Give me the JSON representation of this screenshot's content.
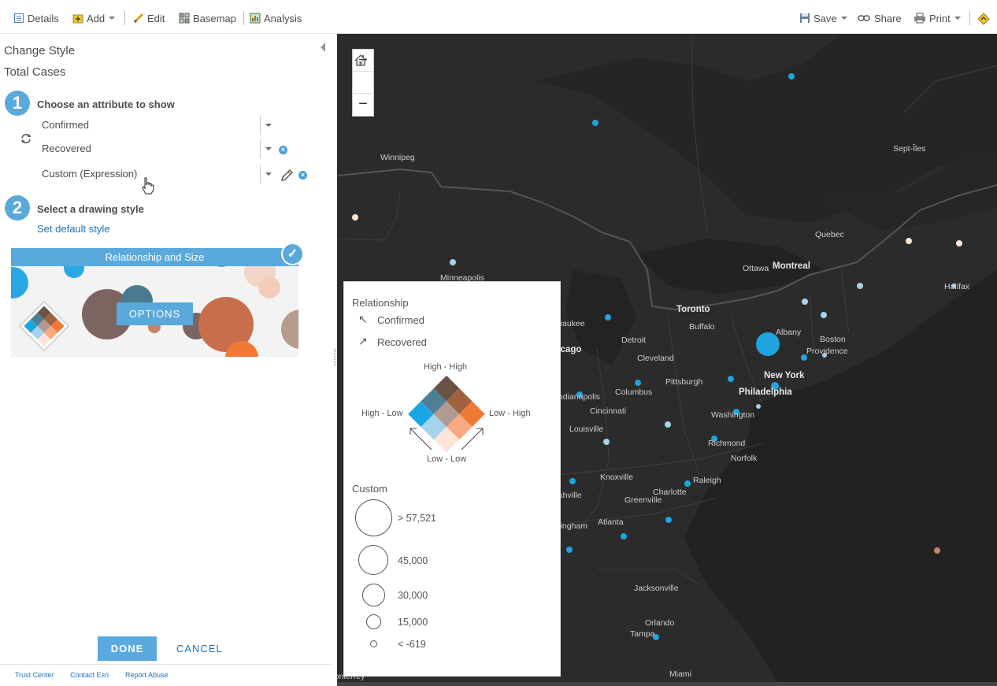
{
  "toolbar": {
    "details": "Details",
    "add": "Add",
    "edit": "Edit",
    "basemap": "Basemap",
    "analysis": "Analysis",
    "save": "Save",
    "share": "Share",
    "print": "Print"
  },
  "panel": {
    "title": "Change Style",
    "subtitle": "Total Cases",
    "step1": {
      "number": "1",
      "label": "Choose an attribute to show"
    },
    "attributes": [
      "Confirmed",
      "Recovered",
      "Custom (Expression)"
    ],
    "step2": {
      "number": "2",
      "label": "Select a drawing style"
    },
    "set_default": "Set default style",
    "style_card": {
      "title": "Relationship and Size",
      "options_label": "OPTIONS"
    },
    "done_label": "DONE",
    "cancel_label": "CANCEL",
    "footer": [
      "Trust Center",
      "Contact Esri",
      "Report Abuse"
    ]
  },
  "legend": {
    "relationship_title": "Relationship",
    "field1": "Confirmed",
    "field2": "Recovered",
    "high_high": "High - High",
    "high_low": "High - Low",
    "low_high": "Low - High",
    "low_low": "Low - Low",
    "custom_title": "Custom",
    "sizes": [
      "> 57,521",
      "45,000",
      "30,000",
      "15,000",
      "< -619"
    ]
  },
  "map": {
    "cities": [
      "Winnipeg",
      "Sept-Îles",
      "Quebec",
      "Ottawa",
      "Montreal",
      "Halifax",
      "Minneapolis",
      "Toronto",
      "Buffalo",
      "Albany",
      "Boston",
      "Providence",
      "Detroit",
      "Cleveland",
      "New York",
      "Pittsburgh",
      "Philadelphia",
      "Columbus",
      "Indianapolis",
      "Cincinnati",
      "Washington",
      "Louisville",
      "Richmond",
      "Norfolk",
      "Nashville",
      "Knoxville",
      "Raleigh",
      "Charlotte",
      "Greenville",
      "Atlanta",
      "Birmingham",
      "Jacksonville",
      "Orlando",
      "Tampa",
      "Miami",
      "Monterrey",
      "Milwaukee",
      "Chicago"
    ]
  },
  "colors": {
    "accent": "#5aa9dd",
    "map_bg": "#2b2b2c",
    "high_high": "#6a5346",
    "high_low": "#1aa6e3",
    "low_high": "#f07a35",
    "low_low": "#fbe6d9"
  }
}
